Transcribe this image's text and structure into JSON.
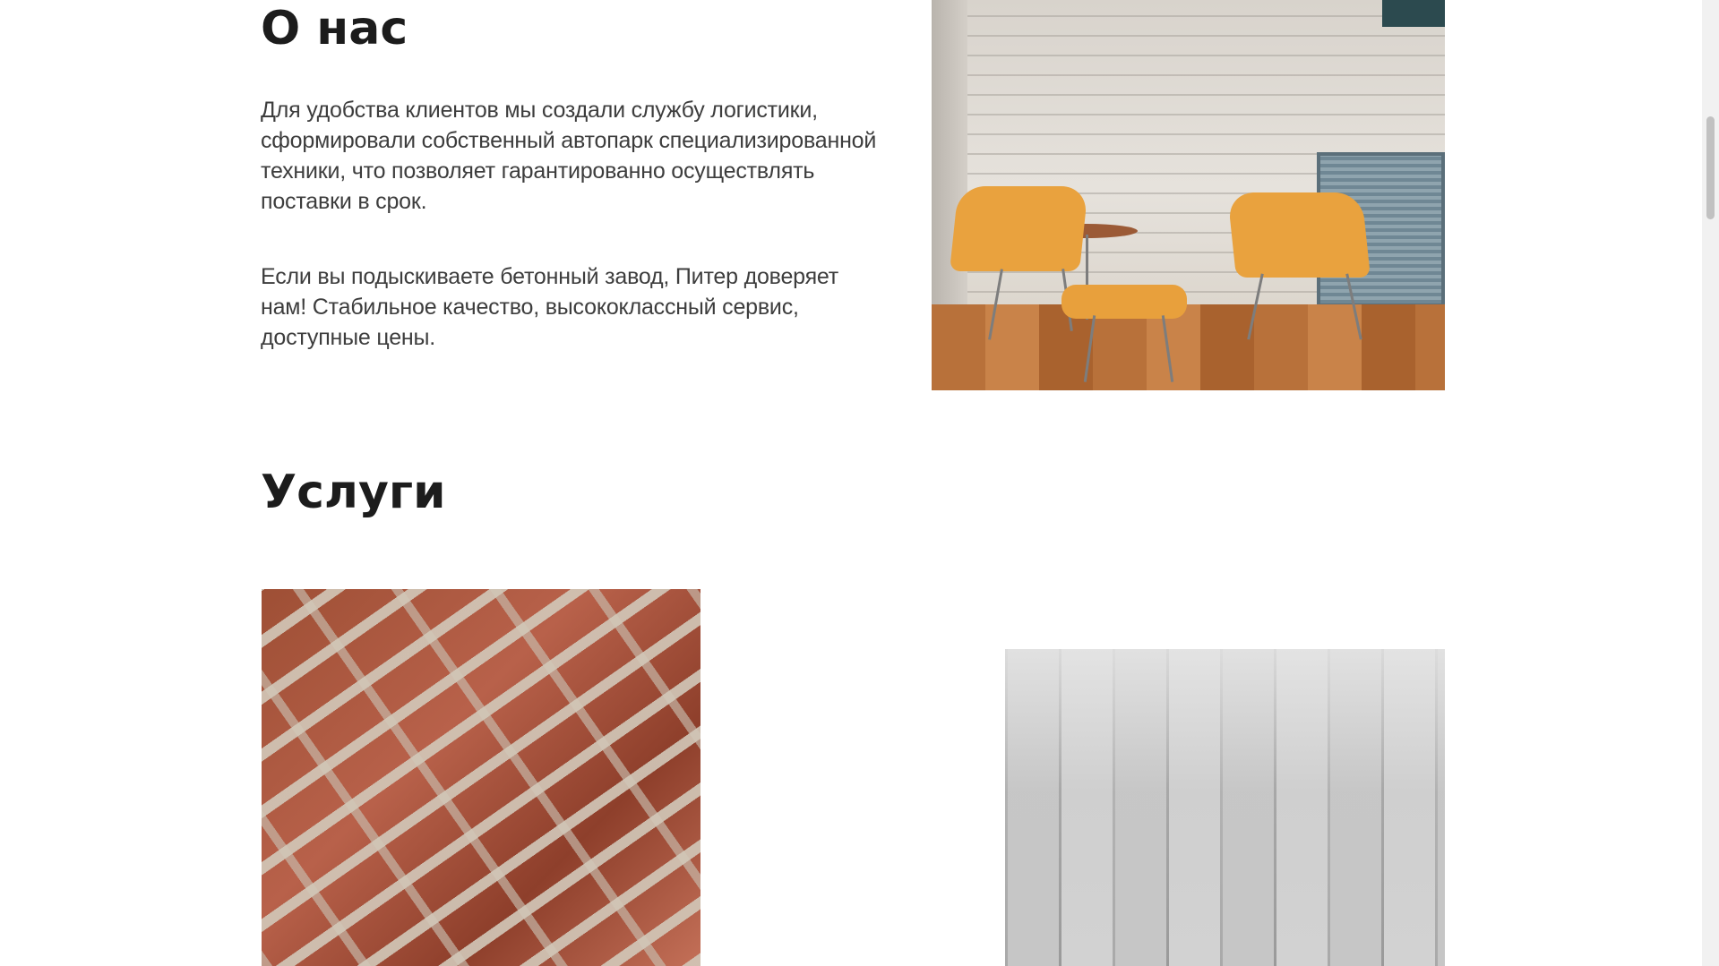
{
  "about": {
    "title": "О нас",
    "paragraph_1": "Для удобства клиентов мы создали службу логистики, сформировали собственный автопарк специализированной техники, что позволяет гарантированно осуществлять поставки в срок.",
    "paragraph_2": "Если вы подыскиваете бетонный завод, Питер доверяет нам! Стабильное качество, высококлассный сервис, доступные цены.",
    "image": "room-with-orange-chairs"
  },
  "services": {
    "title": "Услуги",
    "images": [
      "brick-wall-mortar",
      "gray-wooden-floor"
    ]
  }
}
